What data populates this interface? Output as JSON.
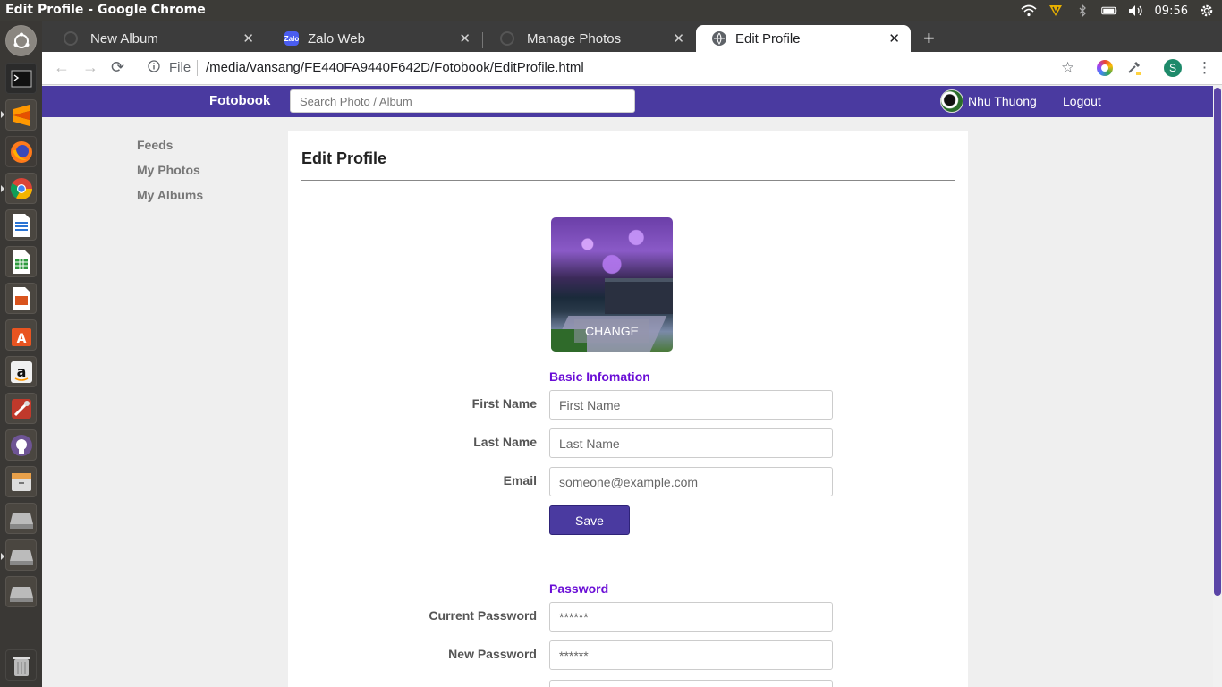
{
  "os": {
    "window_title": "Edit Profile - Google Chrome",
    "clock": "09:56"
  },
  "tabs": [
    {
      "label": "New Album"
    },
    {
      "label": "Zalo Web",
      "favicon_text": "Zalo"
    },
    {
      "label": "Manage Photos"
    },
    {
      "label": "Edit Profile"
    }
  ],
  "address_bar": {
    "scheme_label": "File",
    "url": "/media/vansang/FE440FA9440F642D/Fotobook/EditProfile.html",
    "profile_initial": "S"
  },
  "navbar": {
    "brand": "Fotobook",
    "search_placeholder": "Search Photo / Album",
    "user_name": "Nhu Thuong",
    "logout": "Logout"
  },
  "sidebar": {
    "items": [
      {
        "label": "Feeds"
      },
      {
        "label": "My Photos"
      },
      {
        "label": "My Albums"
      }
    ]
  },
  "profile": {
    "title": "Edit Profile",
    "change_label": "CHANGE",
    "basic_heading": "Basic Infomation",
    "first_name_label": "First Name",
    "first_name_placeholder": "First Name",
    "last_name_label": "Last Name",
    "last_name_placeholder": "Last Name",
    "email_label": "Email",
    "email_placeholder": "someone@example.com",
    "save_label": "Save",
    "password_heading": "Password",
    "current_password_label": "Current Password",
    "current_password_placeholder": "******",
    "new_password_label": "New Password",
    "new_password_placeholder": "******"
  },
  "colors": {
    "brand": "#4a3aa0",
    "section_heading": "#6a0dd6"
  }
}
